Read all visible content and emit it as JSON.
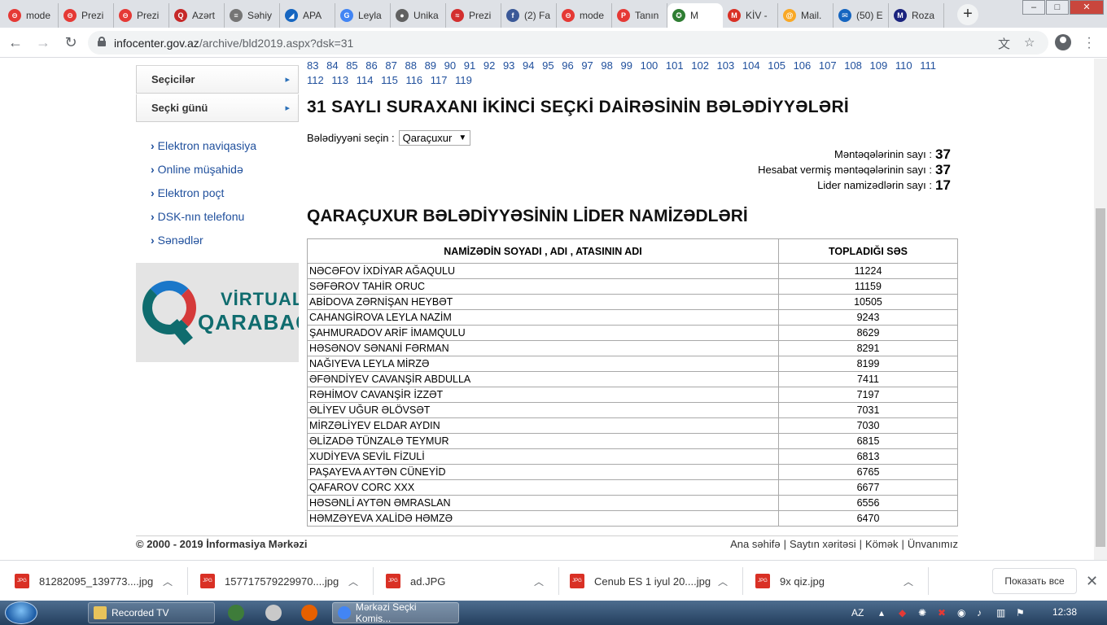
{
  "browser": {
    "tabs": [
      {
        "title": "mode",
        "color": "#e53935",
        "glyph": "⊖"
      },
      {
        "title": "Prezi",
        "color": "#e53935",
        "glyph": "⊖"
      },
      {
        "title": "Prezi",
        "color": "#e53935",
        "glyph": "⊖"
      },
      {
        "title": "Azərt",
        "color": "#c62828",
        "glyph": "Q"
      },
      {
        "title": "Səhiy",
        "color": "#757575",
        "glyph": "≡"
      },
      {
        "title": "APA",
        "color": "#1565c0",
        "glyph": "◢"
      },
      {
        "title": "Leyla",
        "color": "#4285f4",
        "glyph": "G"
      },
      {
        "title": "Unika",
        "color": "#616161",
        "glyph": "●"
      },
      {
        "title": "Prezi",
        "color": "#d32f2f",
        "glyph": "≈"
      },
      {
        "title": "(2) Fa",
        "color": "#3b5998",
        "glyph": "f"
      },
      {
        "title": "mode",
        "color": "#e53935",
        "glyph": "⊖"
      },
      {
        "title": "Tanın",
        "color": "#e53935",
        "glyph": "P"
      },
      {
        "title": "M",
        "color": "#2e7d32",
        "glyph": "✪",
        "active": true
      },
      {
        "title": "KİV -",
        "color": "#d93025",
        "glyph": "M"
      },
      {
        "title": "Mail.",
        "color": "#f9a825",
        "glyph": "@"
      },
      {
        "title": "(50) E",
        "color": "#1565c0",
        "glyph": "✉"
      },
      {
        "title": "Roza",
        "color": "#1a237e",
        "glyph": "M"
      }
    ],
    "url_host": "infocenter.gov.az",
    "url_path": "/archive/bld2019.aspx?dsk=31"
  },
  "sidebar": {
    "menu": [
      "Seçicilər",
      "Seçki günü"
    ],
    "links": [
      "Elektron naviqasiya",
      "Online müşahidə",
      "Elektron poçt",
      "DSK-nın telefonu",
      "Sənədlər"
    ],
    "banner_line1": "VİRTUAL",
    "banner_line2": "QARABAĞ"
  },
  "pager": {
    "pages": [
      "83",
      "84",
      "85",
      "86",
      "87",
      "88",
      "89",
      "90",
      "91",
      "92",
      "93",
      "94",
      "95",
      "96",
      "97",
      "98",
      "99",
      "100",
      "101",
      "102",
      "103",
      "104",
      "105",
      "106",
      "107",
      "108",
      "109",
      "110",
      "111",
      "112",
      "113",
      "114",
      "115",
      "116",
      "117",
      "119"
    ]
  },
  "main": {
    "title": "31 SAYLI SURAXANI İKİNCİ SEÇKİ DAİRƏSİNİN BƏLƏDİYYƏLƏRİ",
    "select_label": "Bələdiyyəni seçin :",
    "select_value": "Qaraçuxur",
    "stats": [
      {
        "label": "Məntəqələrinin sayı :",
        "value": "37"
      },
      {
        "label": "Hesabat vermiş məntəqələrinin sayı :",
        "value": "37"
      },
      {
        "label": "Lider namizədlərin sayı :",
        "value": "17"
      }
    ],
    "subtitle": "QARAÇUXUR BƏLƏDİYYƏSİNİN LİDER NAMİZƏDLƏRİ",
    "table_headers": [
      "NAMİZƏDİN SOYADI , ADI , ATASININ ADI",
      "TOPLADIĞI SƏS"
    ],
    "rows": [
      [
        "NƏCƏFOV İXDİYAR AĞAQULU",
        "11224"
      ],
      [
        "SƏFƏROV TAHİR ORUC",
        "11159"
      ],
      [
        "ABİDOVA ZƏRNİŞAN HEYBƏT",
        "10505"
      ],
      [
        "CAHANGİROVA LEYLA NAZİM",
        "9243"
      ],
      [
        "ŞAHMURADOV ARİF İMAMQULU",
        "8629"
      ],
      [
        "HƏSƏNOV SƏNANİ FƏRMAN",
        "8291"
      ],
      [
        "NAĞIYEVA LEYLA MİRZƏ",
        "8199"
      ],
      [
        "ƏFƏNDİYEV CAVANŞİR ABDULLA",
        "7411"
      ],
      [
        "RƏHİMOV CAVANŞİR İZZƏT",
        "7197"
      ],
      [
        "ƏLİYEV UĞUR ƏLÖVSƏT",
        "7031"
      ],
      [
        "MİRZƏLİYEV ELDAR AYDIN",
        "7030"
      ],
      [
        "ƏLİZADƏ TÜNZALƏ TEYMUR",
        "6815"
      ],
      [
        "XUDİYEVA SEVİL FİZULİ",
        "6813"
      ],
      [
        "PAŞAYEVA AYTƏN CÜNEYİD",
        "6765"
      ],
      [
        "QAFAROV CORC XXX",
        "6677"
      ],
      [
        "HƏSƏNLİ AYTƏN ƏMRASLAN",
        "6556"
      ],
      [
        "HƏMZƏYEVA XALİDƏ HƏMZƏ",
        "6470"
      ]
    ]
  },
  "footer": {
    "copyright": "© 2000 - 2019  İnformasiya Mərkəzi",
    "links": [
      "Ana səhifə",
      "Saytın xəritəsi",
      "Kömək",
      "Ünvanımız"
    ]
  },
  "downloads": {
    "items": [
      "81282095_139773....jpg",
      "157717579229970....jpg",
      "ad.JPG",
      "Cenub ES 1 iyul 20....jpg",
      "9x qiz.jpg"
    ],
    "show_all": "Показать все"
  },
  "taskbar": {
    "items": [
      "Recorded TV",
      "Mərkəzi Seçki Komis..."
    ],
    "lang": "AZ",
    "time": "12:38"
  }
}
